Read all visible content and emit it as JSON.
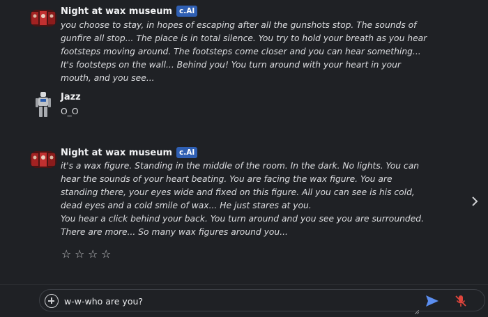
{
  "messages": [
    {
      "author": "Night at wax museum",
      "badge": "c.AI",
      "paragraphs": [
        "you choose to stay, in hopes of escaping after all the gunshots stop. The sounds of gunfire all stop... The place is in total silence. You try to hold your breath as you hear footsteps moving around. The footsteps come closer and you can hear something... It's footsteps on the wall... Behind you! You turn around with your heart in your mouth, and you see..."
      ]
    },
    {
      "author": "Jazz",
      "paragraphs": [
        "O_O"
      ]
    },
    {
      "author": "Night at wax museum",
      "badge": "c.AI",
      "paragraphs": [
        "it's a wax figure. Standing in the middle of the room. In the dark. No lights. You can hear the sounds of your heart beating. You are facing the wax figure. You are standing there, your eyes wide and fixed on this figure. All you can see is his cold, dead eyes and a cold smile of wax... He just stares at you.",
        "You hear a click behind your back. You turn around and you see you are surrounded. There are more... So many wax figures around you..."
      ]
    }
  ],
  "rating": {
    "stars": [
      "☆",
      "☆",
      "☆",
      "☆"
    ]
  },
  "composer": {
    "value": "w-w-who are you?"
  },
  "icons": {
    "plus": "plus-circle-icon",
    "send": "send-icon",
    "mic": "mic-off-icon",
    "next": "chevron-right-icon"
  },
  "colors": {
    "accent": "#2f5fb3",
    "send": "#5b8ef0",
    "mic_off": "#e0453c"
  }
}
